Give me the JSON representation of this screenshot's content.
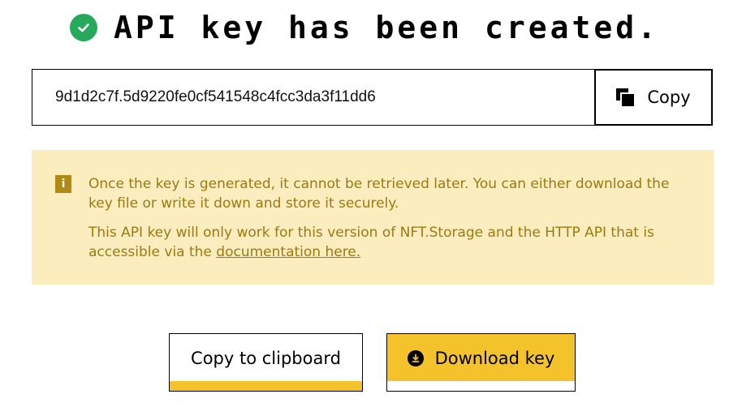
{
  "header": {
    "title": "API key has been created.",
    "icon": "check-circle-icon",
    "icon_color": "#27a95b"
  },
  "key_field": {
    "value": "9d1d2c7f.5d9220fe0cf541548c4fcc3da3f11dd6",
    "copy_label": "Copy",
    "copy_icon": "copy-icon"
  },
  "notice": {
    "icon": "info-icon",
    "line1": "Once the key is generated, it cannot be retrieved later. You can either download the key file or write it down and store it securely.",
    "line2_prefix": "This API key will only work for this version of NFT.Storage and the HTTP API that is accessible via the ",
    "link_text": "documentation here.",
    "background": "#fcedbe",
    "text_color": "#9b7a10"
  },
  "actions": {
    "clipboard_label": "Copy to clipboard",
    "download_label": "Download key",
    "download_icon": "download-circle-icon",
    "accent": "#f4c22b"
  }
}
